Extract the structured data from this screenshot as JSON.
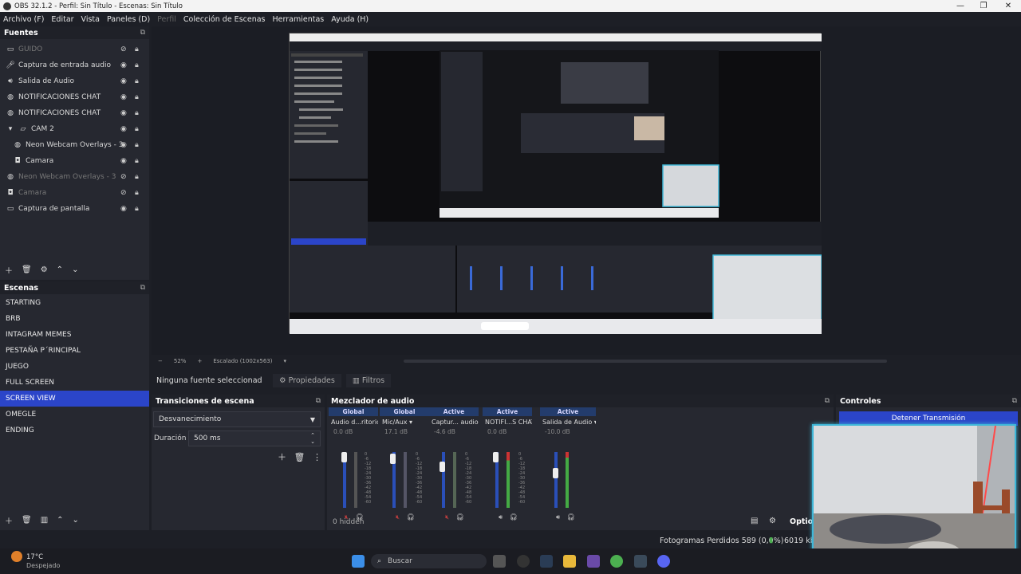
{
  "window": {
    "title": "OBS 32.1.2 - Perfil: Sin Título - Escenas: Sin Título",
    "minimize": "—",
    "maximize": "❐",
    "close": "✕"
  },
  "menu": [
    "Archivo (F)",
    "Editar",
    "Vista",
    "Paneles (D)",
    "Perfil",
    "Colección de Escenas",
    "Herramientas",
    "Ayuda (H)"
  ],
  "sources": {
    "title": "Fuentes",
    "items": [
      {
        "label": "GUIDO",
        "icon": "text-icon",
        "dim": true
      },
      {
        "label": "Captura de entrada audio",
        "icon": "microphone-icon",
        "dim": false
      },
      {
        "label": "Salida de Audio",
        "icon": "speaker-icon",
        "dim": false
      },
      {
        "label": "NOTIFICACIONES CHAT",
        "icon": "globe-icon",
        "dim": false
      },
      {
        "label": "NOTIFICACIONES CHAT",
        "icon": "globe-icon",
        "dim": false
      },
      {
        "label": "CAM 2",
        "icon": "folder-icon",
        "dim": false
      },
      {
        "label": "Neon Webcam Overlays - 3",
        "icon": "globe-icon",
        "dim": false
      },
      {
        "label": "Camara",
        "icon": "camera-icon",
        "dim": false
      },
      {
        "label": "Neon Webcam Overlays - 3",
        "icon": "globe-icon",
        "dim": true
      },
      {
        "label": "Camara",
        "icon": "camera-icon",
        "dim": true
      },
      {
        "label": "Captura de pantalla",
        "icon": "monitor-icon",
        "dim": false
      }
    ]
  },
  "scenes": {
    "title": "Escenas",
    "items": [
      "STARTING",
      "BRB",
      "INTAGRAM MEMES",
      "PESTAÑA P´RINCIPAL",
      "JUEGO",
      "FULL SCREEN",
      "SCREEN VIEW",
      "OMEGLE",
      "ENDING"
    ],
    "selected": "SCREEN VIEW"
  },
  "preview": {
    "zoom": "52%",
    "scaling": "Escalado (1002x563)"
  },
  "properties_bar": {
    "no_source": "Ninguna fuente seleccionad",
    "properties_tab": "Propiedades",
    "filters_tab": "Filtros"
  },
  "transitions": {
    "title": "Transiciones de escena",
    "selected": "Desvanecimiento",
    "duration_label": "Duración",
    "duration_value": "500 ms"
  },
  "mixer": {
    "title": "Mezclador de audio",
    "hidden": "0 hidden",
    "channels": [
      {
        "tag": "Global",
        "name": "Audio d...ritorio",
        "db": "0.0 dB",
        "muted": true
      },
      {
        "tag": "Global",
        "name": "Mic/Aux",
        "db": "17.1 dB",
        "muted": true
      },
      {
        "tag": "Active",
        "name": "Captur... audio",
        "db": "-4.6 dB",
        "muted": true
      },
      {
        "tag": "Active",
        "name": "NOTIFI...S CHAT",
        "db": "0.0 dB",
        "muted": false
      },
      {
        "tag": "Active",
        "name": "Salida de Audio",
        "db": "-10.0 dB",
        "muted": false
      }
    ],
    "ticks": [
      "0",
      "-6",
      "-12",
      "-18",
      "-24",
      "-30",
      "-36",
      "-42",
      "-48",
      "-54",
      "-60"
    ],
    "options": "Option"
  },
  "controls": {
    "title": "Controles",
    "stop_stream": "Detener Transmisión"
  },
  "status": {
    "dropped": "Fotogramas Perdidos 589 (0,0%)",
    "bitrate": "6019 kbp"
  },
  "taskbar": {
    "temperature": "17°C",
    "weather": "Despejado",
    "search": "Buscar"
  },
  "colors": {
    "accent": "#2b45c9",
    "webcam_border": "#3fb7d8"
  }
}
